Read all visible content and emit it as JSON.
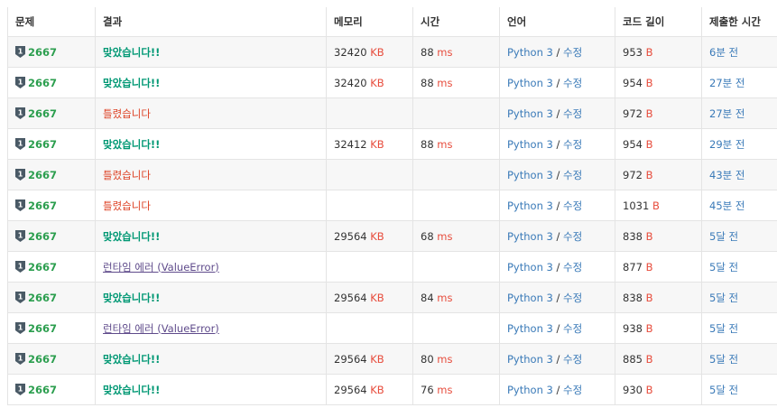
{
  "headers": [
    "문제",
    "결과",
    "메모리",
    "시간",
    "언어",
    "코드 길이",
    "제출한 시간"
  ],
  "units": {
    "memory": "KB",
    "time": "ms",
    "code": "B"
  },
  "lang_separator": "/",
  "rows": [
    {
      "problem": "2667",
      "result": "맞았습니다!!",
      "status": "ac",
      "memory": "32420",
      "time": "88",
      "lang": "Python 3",
      "edit": "수정",
      "code": "953",
      "submitted": "6분 전"
    },
    {
      "problem": "2667",
      "result": "맞았습니다!!",
      "status": "ac",
      "memory": "32420",
      "time": "88",
      "lang": "Python 3",
      "edit": "수정",
      "code": "954",
      "submitted": "27분 전"
    },
    {
      "problem": "2667",
      "result": "틀렸습니다",
      "status": "wa",
      "memory": "",
      "time": "",
      "lang": "Python 3",
      "edit": "수정",
      "code": "972",
      "submitted": "27분 전"
    },
    {
      "problem": "2667",
      "result": "맞았습니다!!",
      "status": "ac",
      "memory": "32412",
      "time": "88",
      "lang": "Python 3",
      "edit": "수정",
      "code": "954",
      "submitted": "29분 전"
    },
    {
      "problem": "2667",
      "result": "틀렸습니다",
      "status": "wa",
      "memory": "",
      "time": "",
      "lang": "Python 3",
      "edit": "수정",
      "code": "972",
      "submitted": "43분 전"
    },
    {
      "problem": "2667",
      "result": "틀렸습니다",
      "status": "wa",
      "memory": "",
      "time": "",
      "lang": "Python 3",
      "edit": "수정",
      "code": "1031",
      "submitted": "45분 전"
    },
    {
      "problem": "2667",
      "result": "맞았습니다!!",
      "status": "ac",
      "memory": "29564",
      "time": "68",
      "lang": "Python 3",
      "edit": "수정",
      "code": "838",
      "submitted": "5달 전"
    },
    {
      "problem": "2667",
      "result": "런타임 에러 (ValueError)",
      "status": "rte",
      "memory": "",
      "time": "",
      "lang": "Python 3",
      "edit": "수정",
      "code": "877",
      "submitted": "5달 전"
    },
    {
      "problem": "2667",
      "result": "맞았습니다!!",
      "status": "ac",
      "memory": "29564",
      "time": "84",
      "lang": "Python 3",
      "edit": "수정",
      "code": "838",
      "submitted": "5달 전"
    },
    {
      "problem": "2667",
      "result": "런타임 에러 (ValueError)",
      "status": "rte",
      "memory": "",
      "time": "",
      "lang": "Python 3",
      "edit": "수정",
      "code": "938",
      "submitted": "5달 전"
    },
    {
      "problem": "2667",
      "result": "맞았습니다!!",
      "status": "ac",
      "memory": "29564",
      "time": "80",
      "lang": "Python 3",
      "edit": "수정",
      "code": "885",
      "submitted": "5달 전"
    },
    {
      "problem": "2667",
      "result": "맞았습니다!!",
      "status": "ac",
      "memory": "29564",
      "time": "76",
      "lang": "Python 3",
      "edit": "수정",
      "code": "930",
      "submitted": "5달 전"
    }
  ],
  "icons": {
    "tier": "tier-badge-icon"
  },
  "colors": {
    "accepted": "#009874",
    "wrong": "#dd4124",
    "runtime_error": "#5f4b8b",
    "unit": "#e74c3c",
    "link": "#3a7ab8",
    "problem": "#2b9e4e"
  }
}
